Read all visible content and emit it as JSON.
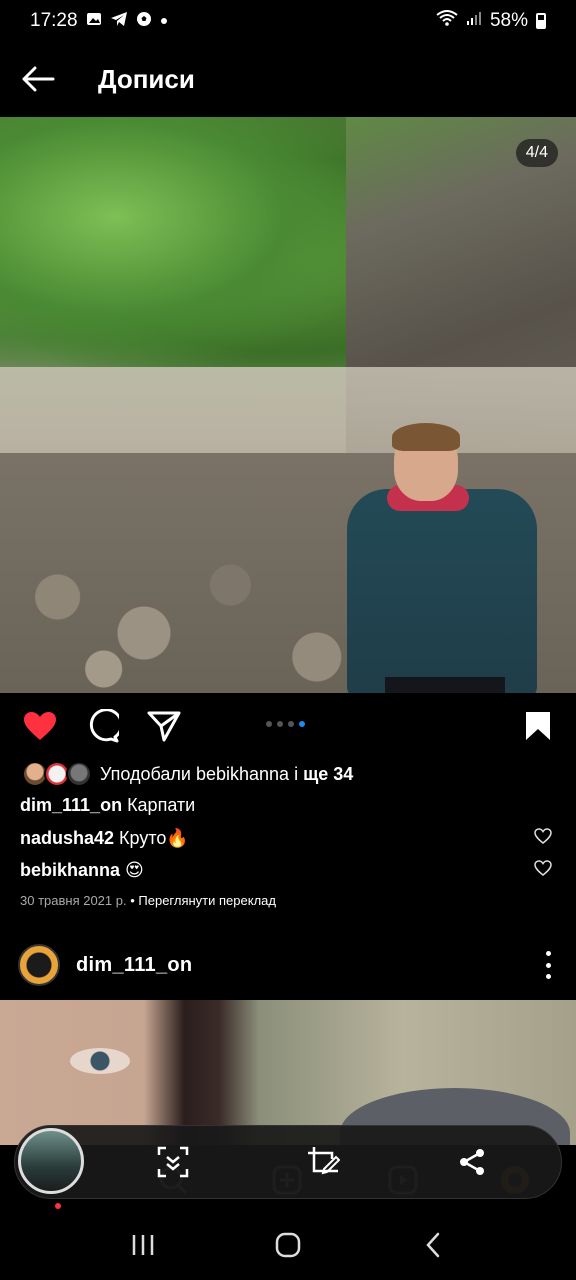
{
  "status_bar": {
    "time": "17:28",
    "battery": "58%",
    "icons": [
      "gallery-icon",
      "telegram-icon",
      "soccer-icon",
      "dot-icon",
      "wifi-icon",
      "signal-icon",
      "battery-icon"
    ]
  },
  "header": {
    "title": "Дописи",
    "back_icon": "arrow-left-icon"
  },
  "post1": {
    "image_counter": "4/4",
    "carousel": {
      "count": 4,
      "active_index": 3
    },
    "liked": true,
    "likes_prefix": "Уподобали ",
    "likes_user": "bebikhanna",
    "likes_middle": " і ",
    "likes_rest": "ще 34",
    "caption_user": "dim_111_on",
    "caption_text": " Карпати",
    "comments": [
      {
        "user": "nadusha42",
        "text": " Круто🔥"
      },
      {
        "user": "bebikhanna",
        "text": " 😍"
      }
    ],
    "date": "30 травня 2021 р.",
    "translate_sep": " • ",
    "translate_link": "Переглянути переклад"
  },
  "post2": {
    "username": "dim_111_on"
  },
  "toolbar": {
    "icons": [
      "screenshot-thumbnail",
      "scroll-capture-icon",
      "edit-crop-icon",
      "share-icon"
    ]
  },
  "colors": {
    "like_red": "#ff3040",
    "carousel_active": "#1d8cf0"
  }
}
